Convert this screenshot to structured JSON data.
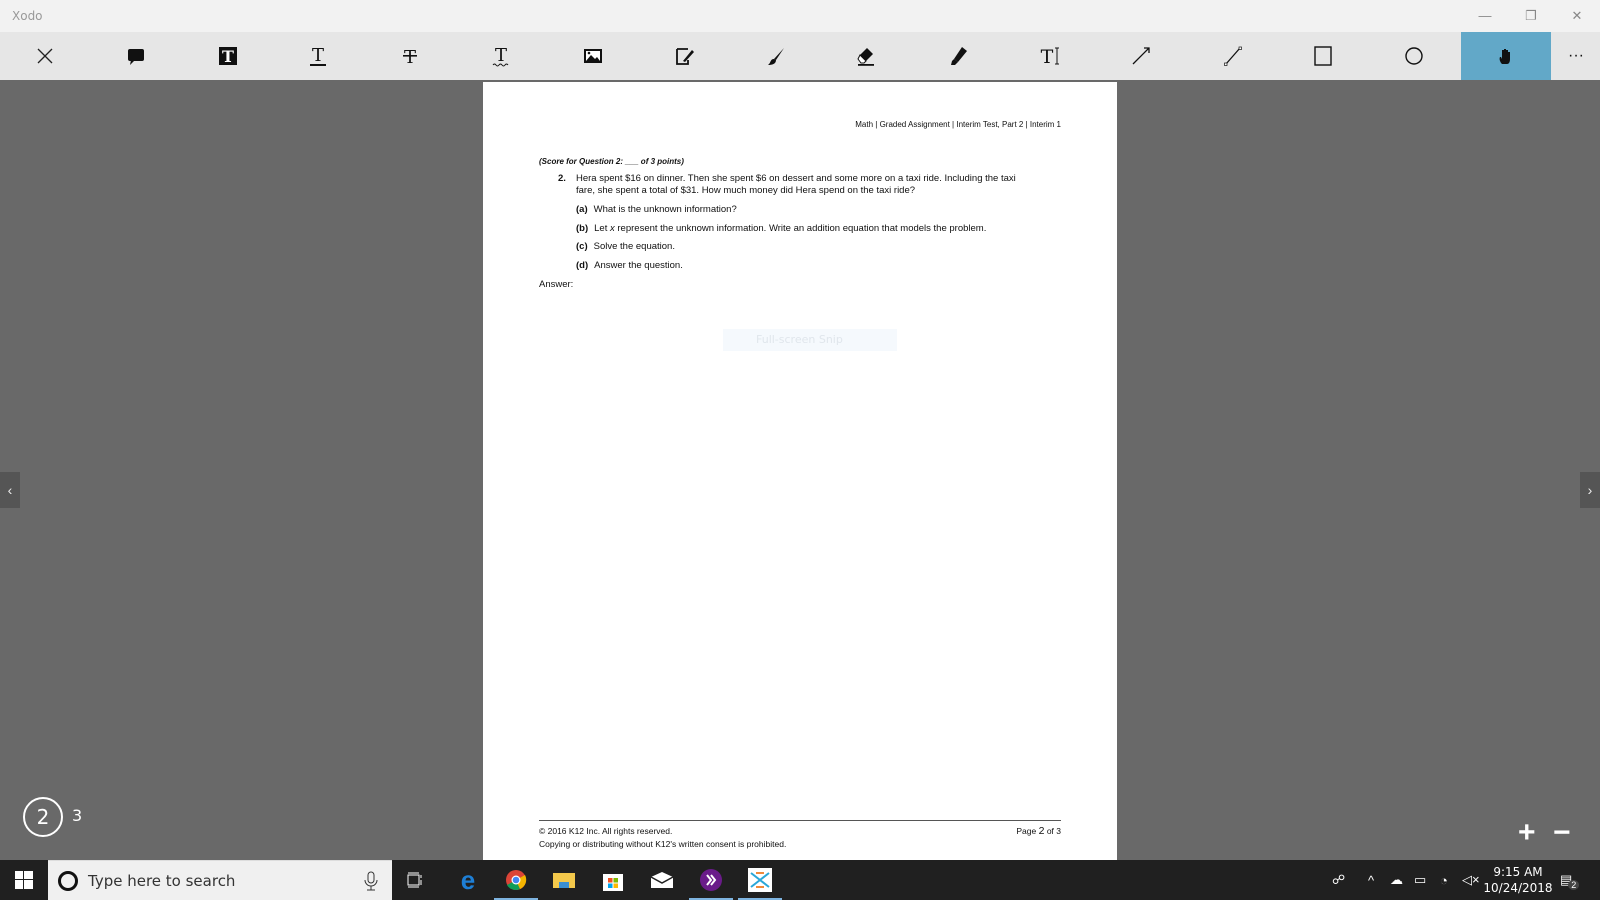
{
  "app": {
    "title": "Xodo"
  },
  "window": {
    "minimize": "—",
    "restore": "❐",
    "close": "✕"
  },
  "toolbar": {
    "more": "···"
  },
  "document": {
    "header": "Math | Graded Assignment | Interim Test, Part 2 | Interim 1",
    "score_line": "(Score for Question 2: ___ of 3 points)",
    "question_number": "2.",
    "question_line1": "Hera spent $16 on dinner. Then she spent $6 on dessert and some more on a taxi ride. Including the taxi",
    "question_line2": "fare, she spent a total of $31. How much money did Hera spend on the taxi ride?",
    "parts": [
      {
        "label": "(a)",
        "text": "What is the unknown information?"
      },
      {
        "label": "(b)",
        "text_pre": "Let ",
        "var": "x",
        "text": " represent the unknown information. Write an addition equation that models the problem."
      },
      {
        "label": "(c)",
        "text": "Solve the equation."
      },
      {
        "label": "(d)",
        "text": "Answer the question."
      }
    ],
    "answer_label": "Answer:",
    "footer_copyright": "© 2016 K12 Inc. All rights reserved.",
    "footer_page_pre": "Page ",
    "footer_page_num": "2",
    "footer_page_post": " of 3",
    "footer_notice": "Copying or distributing without K12's written consent is prohibited."
  },
  "overlay": {
    "snip_label": "Full-screen Snip"
  },
  "navigation": {
    "prev": "‹",
    "next": "›",
    "current_page": "2",
    "total_pages": "3",
    "zoom_in": "+",
    "zoom_out": "−"
  },
  "taskbar": {
    "search_placeholder": "Type here to search",
    "time": "9:15 AM",
    "date": "10/24/2018",
    "notification_count": "2"
  }
}
